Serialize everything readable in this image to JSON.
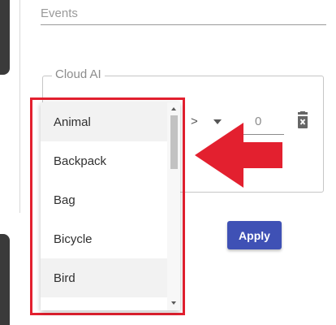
{
  "form": {
    "events_label": "Events",
    "cloud_ai_legend": "Cloud AI",
    "operator": ">",
    "value": "0",
    "apply_label": "Apply"
  },
  "dropdown": {
    "items": [
      {
        "label": "Animal"
      },
      {
        "label": "Backpack"
      },
      {
        "label": "Bag"
      },
      {
        "label": "Bicycle"
      },
      {
        "label": "Bird"
      }
    ]
  },
  "icons": {
    "trash": "trash-icon",
    "arrow": "arrow-left-icon",
    "caret": "caret-down-icon"
  },
  "colors": {
    "accent": "#3f51b5",
    "highlight": "#e3202f"
  }
}
